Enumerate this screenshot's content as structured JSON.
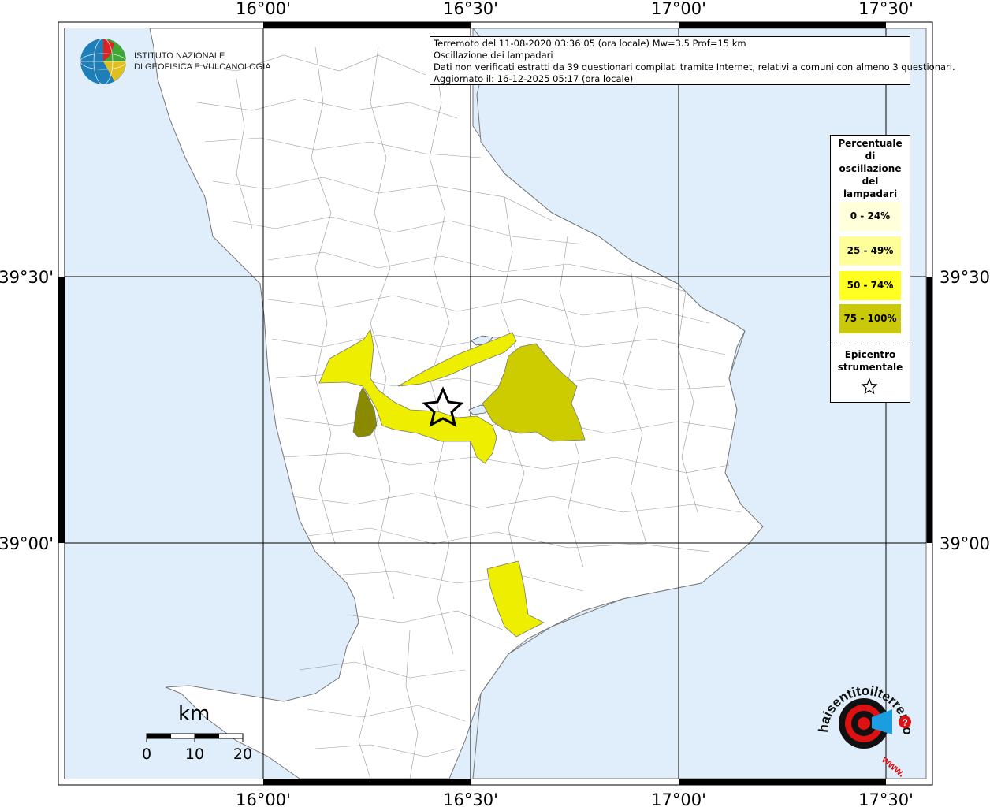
{
  "header": {
    "line1": "Terremoto del 11-08-2020 03:36:05 (ora locale) Mw=3.5 Prof=15 km",
    "line2": "Oscillazione dei lampadari",
    "line3": "Dati non verificati estratti da 39 questionari compilati tramite Internet, relativi a comuni con almeno 3 questionari.",
    "line4": "Aggiornato il: 16-12-2025 05:17 (ora locale)"
  },
  "coords": {
    "lon_16_00": "16°00'",
    "lon_16_30": "16°30'",
    "lon_17_00": "17°00'",
    "lon_17_30": "17°30'",
    "lat_39_30": "39°30'",
    "lat_39_00": "39°00'"
  },
  "logo_ingv": {
    "line1": "ISTITUTO NAZIONALE",
    "line2": "DI GEOFISICA E VULCANOLOGIA"
  },
  "logo_hai": {
    "text": "haisentitoilterremoto.it",
    "www": "www.",
    "q": "?"
  },
  "legend": {
    "title": [
      "Percentuale",
      "di",
      "oscillazione",
      "del",
      "lampadari"
    ],
    "items": [
      {
        "label": "0 - 24%",
        "color": "#ffffd9"
      },
      {
        "label": "25 - 49%",
        "color": "#ffff99"
      },
      {
        "label": "50 - 74%",
        "color": "#ffff22"
      },
      {
        "label": "75 - 100%",
        "color": "#c9c90a"
      }
    ],
    "epicenter": [
      "Epicentro",
      "strumentale"
    ]
  },
  "scale": {
    "unit": "km",
    "ticks": [
      "0",
      "10",
      "20"
    ]
  },
  "colors": {
    "sea": "#dfeefa",
    "land": "#ffffff",
    "class_50_74": "#eeee00",
    "class_75_100_light": "#cccc00",
    "class_75_100_dark": "#8a8a00",
    "class_25_49": "#ffff99"
  }
}
